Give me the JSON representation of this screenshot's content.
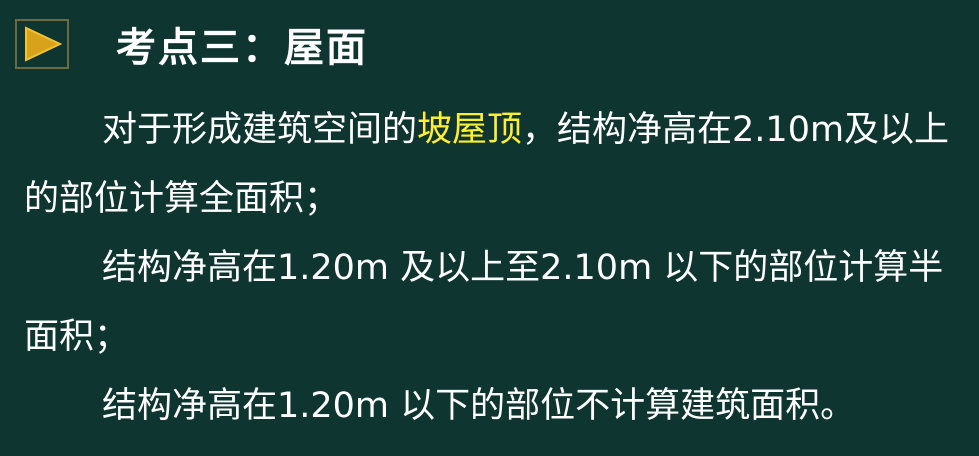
{
  "title": "考点三：屋面",
  "paragraphs": [
    {
      "before": "对于形成建筑空间的",
      "highlight": "坡屋顶",
      "after": "，结构净高在2.10m及以上的部位计算全面积；"
    },
    {
      "text": "结构净高在1.20m 及以上至2.10m 以下的部位计算半面积；"
    },
    {
      "text": "结构净高在1.20m 以下的部位不计算建筑面积。"
    }
  ],
  "colors": {
    "background": "#0f3530",
    "text": "#ffffff",
    "highlight": "#ffee33",
    "icon_fill": "#d9a21b",
    "icon_frame": "#6b6a40"
  },
  "icons": {
    "bullet": "play-triangle-icon"
  }
}
